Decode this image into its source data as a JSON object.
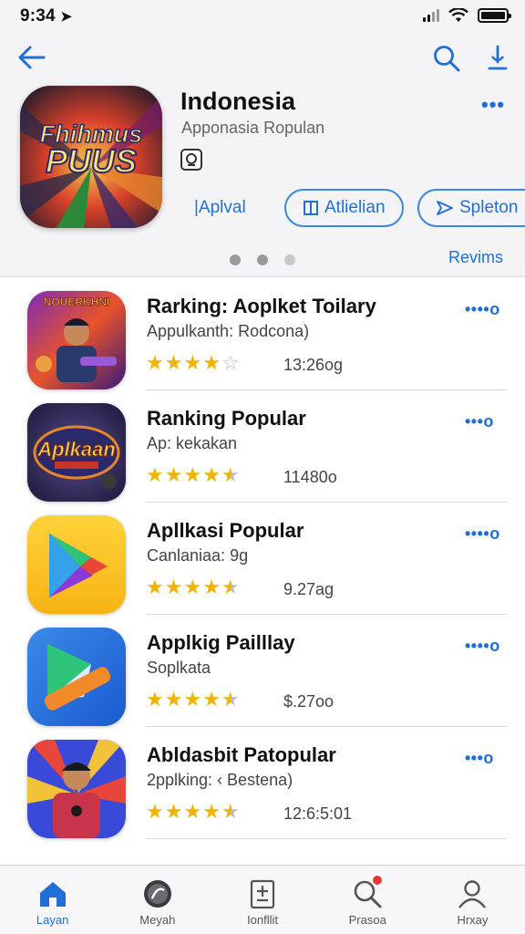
{
  "status_bar": {
    "time": "9:34"
  },
  "header": {
    "title": "Indonesia",
    "subtitle": "Apponasia Ropulan",
    "more_label": "•••",
    "buttons": [
      {
        "label": "|Aplval"
      },
      {
        "label": "Atlielian"
      },
      {
        "label": "Spleton"
      }
    ],
    "reviews_link": "Revims",
    "hero_icon_text": [
      "Fhihmus",
      "PUUS"
    ]
  },
  "apps": [
    {
      "title": "Rarking: Aoplket Toilary",
      "subtitle": "Appulkanth: Rodcona)",
      "size": "13:26og",
      "rating": 4.0,
      "more": "••••o",
      "icon_text": "NOUERKHNI"
    },
    {
      "title": "Ranking Popular",
      "subtitle": "Ap: kekakan",
      "size": "11480o",
      "rating": 4.5,
      "more": "•••o",
      "icon_text": "Aplkaan"
    },
    {
      "title": "Apllkasi Popular",
      "subtitle": "Canlaniaa: 9g",
      "size": "9.27ag",
      "rating": 4.5,
      "more": "••••o",
      "icon_text": ""
    },
    {
      "title": "Applkig Pailllay",
      "subtitle": "Soplkata",
      "size": "$.27oo",
      "rating": 4.5,
      "more": "••••o",
      "icon_text": ""
    },
    {
      "title": "Abldasbit Patopular",
      "subtitle": "2pplking: ‹ Bestena)",
      "size": "12:6:5:01",
      "rating": 4.5,
      "more": "•••o",
      "icon_text": ""
    }
  ],
  "tabbar": [
    {
      "label": "Layan",
      "icon": "home-icon",
      "active": true
    },
    {
      "label": "Meyah",
      "icon": "compass-icon",
      "active": false
    },
    {
      "label": "Ionfllit",
      "icon": "clipboard-icon",
      "active": false
    },
    {
      "label": "Prasoa",
      "icon": "search-icon",
      "active": false,
      "badge": true
    },
    {
      "label": "Hrxay",
      "icon": "person-icon",
      "active": false
    }
  ],
  "colors": {
    "accent": "#1f6fd6",
    "star": "#f0b400",
    "badge": "#e23a2e"
  }
}
